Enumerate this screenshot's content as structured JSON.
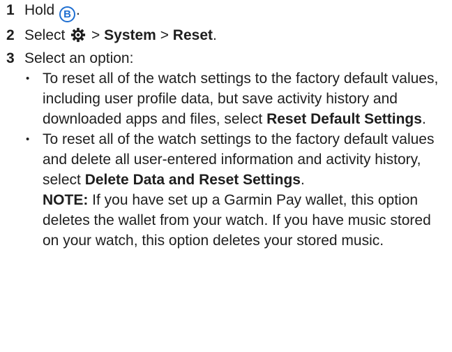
{
  "steps": [
    {
      "num": "1",
      "prefix": "Hold ",
      "button_letter": "B",
      "suffix": "."
    },
    {
      "num": "2",
      "prefix": "Select ",
      "sep1": " > ",
      "system": "System",
      "sep2": " > ",
      "reset": "Reset",
      "suffix": "."
    },
    {
      "num": "3",
      "text": "Select an option:",
      "options": [
        {
          "bullet": "•",
          "text": "To reset all of the watch settings to the factory default values, including user profile data, but save activity history and downloaded apps and files, select ",
          "bold": "Reset Default Settings",
          "suffix": "."
        },
        {
          "bullet": "•",
          "text": "To reset all of the watch settings to the factory default values and delete all user-entered information and activity history, select ",
          "bold": "Delete Data and Reset Settings",
          "suffix": ".",
          "note_label": "NOTE:",
          "note_text": " If you have set up a Garmin Pay wallet, this option deletes the wallet from your watch. If you have music stored on your watch, this option deletes your stored music."
        }
      ]
    }
  ],
  "icons": {
    "settings": "gear-icon",
    "button": "b-button-icon"
  },
  "colors": {
    "text": "#1e1e1e",
    "accent": "#1f6fd1"
  }
}
